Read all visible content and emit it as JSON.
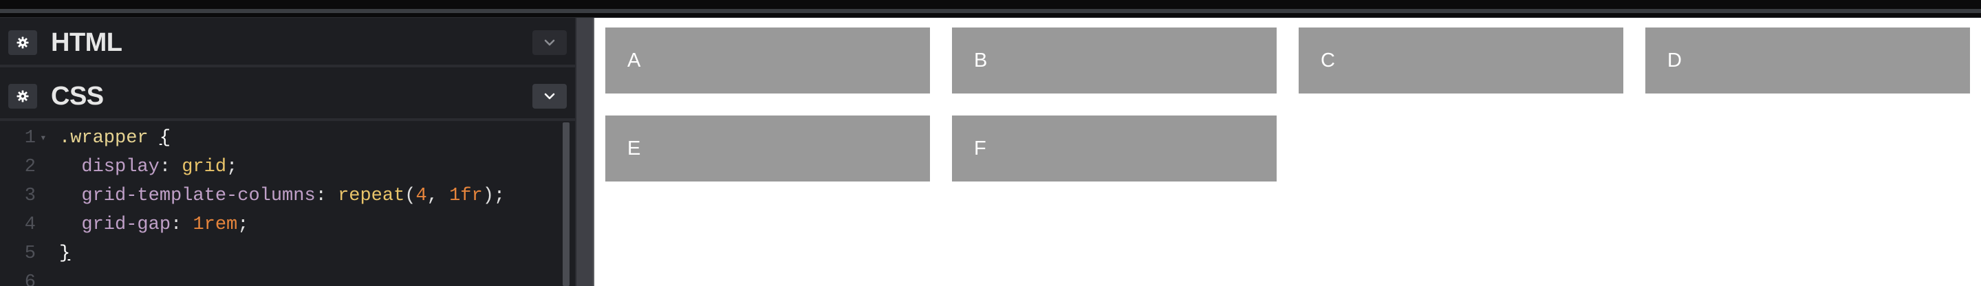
{
  "editor": {
    "html_panel": {
      "title": "HTML",
      "settings_icon": "gear-icon",
      "collapse_icon": "chevron-down-icon"
    },
    "css_panel": {
      "title": "CSS",
      "settings_icon": "gear-icon",
      "collapse_icon": "chevron-down-icon"
    },
    "code_lines": [
      {
        "num": "1",
        "tokens": [
          {
            "t": ".wrapper ",
            "c": "tok-selector"
          },
          {
            "t": "{",
            "c": "tok-brace"
          }
        ]
      },
      {
        "num": "2",
        "tokens": [
          {
            "t": "  display",
            "c": "tok-prop"
          },
          {
            "t": ": ",
            "c": "tok-punct"
          },
          {
            "t": "grid",
            "c": "tok-value"
          },
          {
            "t": ";",
            "c": "tok-punct"
          }
        ]
      },
      {
        "num": "3",
        "tokens": [
          {
            "t": "  grid-template-columns",
            "c": "tok-prop"
          },
          {
            "t": ": ",
            "c": "tok-punct"
          },
          {
            "t": "repeat",
            "c": "tok-func"
          },
          {
            "t": "(",
            "c": "tok-punct"
          },
          {
            "t": "4",
            "c": "tok-num"
          },
          {
            "t": ", ",
            "c": "tok-punct"
          },
          {
            "t": "1fr",
            "c": "tok-num"
          },
          {
            "t": ");",
            "c": "tok-punct"
          }
        ]
      },
      {
        "num": "4",
        "tokens": [
          {
            "t": "  grid-gap",
            "c": "tok-prop"
          },
          {
            "t": ": ",
            "c": "tok-punct"
          },
          {
            "t": "1rem",
            "c": "tok-num"
          },
          {
            "t": ";",
            "c": "tok-punct"
          }
        ]
      },
      {
        "num": "5",
        "tokens": [
          {
            "t": "}",
            "c": "tok-brace"
          }
        ]
      },
      {
        "num": "6",
        "tokens": []
      }
    ]
  },
  "preview": {
    "boxes": [
      "A",
      "B",
      "C",
      "D",
      "E",
      "F"
    ],
    "box_color": "#999999",
    "text_color": "#ffffff"
  },
  "colors": {
    "editor_bg": "#1d1e22",
    "accent_prop": "#c0a0c8",
    "accent_value": "#e9c46a",
    "accent_number": "#e7853c"
  }
}
